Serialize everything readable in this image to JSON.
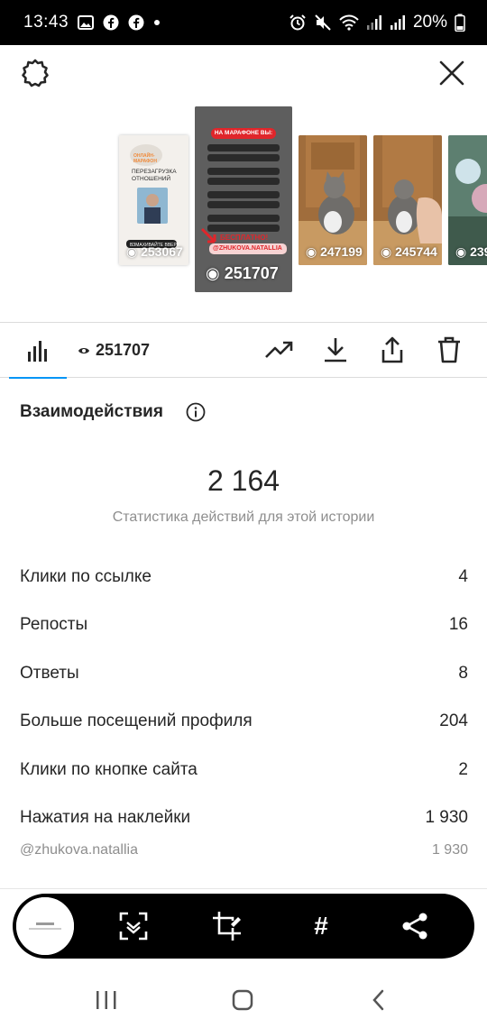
{
  "status": {
    "time": "13:43",
    "battery": "20%"
  },
  "stories": [
    {
      "views": "253067"
    },
    {
      "views": "251707",
      "banner": "НА МАРАФОНЕ ВЫ:",
      "free_label": "БЕСПЛАТНО!",
      "handle": "@ZHUKOVA.NATALLIA"
    },
    {
      "views": "247199"
    },
    {
      "views": "245744"
    },
    {
      "views": "239"
    }
  ],
  "toolbar": {
    "views_count": "251707"
  },
  "interactions": {
    "title": "Взаимодействия",
    "total": "2 164",
    "caption": "Статистика действий для этой истории",
    "rows": [
      {
        "label": "Клики по ссылке",
        "value": "4"
      },
      {
        "label": "Репосты",
        "value": "16"
      },
      {
        "label": "Ответы",
        "value": "8"
      },
      {
        "label": "Больше посещений профиля",
        "value": "204"
      },
      {
        "label": "Клики по кнопке сайта",
        "value": "2"
      },
      {
        "label": "Нажатия на наклейки",
        "value": "1 930"
      }
    ],
    "sub_row": {
      "label": "@zhukova.natallia",
      "value": "1 930"
    }
  },
  "pill": {
    "hashtag_label": "#"
  },
  "icons": {
    "settings": "gear-icon",
    "close": "close-icon",
    "stats": "bar-chart-icon",
    "eye": "eye-icon",
    "trend": "trend-icon",
    "download": "download-icon",
    "share": "share-icon",
    "delete": "trash-icon",
    "info": "info-icon",
    "scan": "scan-icon",
    "crop": "crop-edit-icon",
    "share_pill": "share-nodes-icon",
    "recents": "recents-icon",
    "home": "home-icon",
    "back": "back-icon"
  },
  "colors": {
    "accent": "#0095f6",
    "banner_red": "#e0262b",
    "muted_text": "#8e8e8e"
  }
}
